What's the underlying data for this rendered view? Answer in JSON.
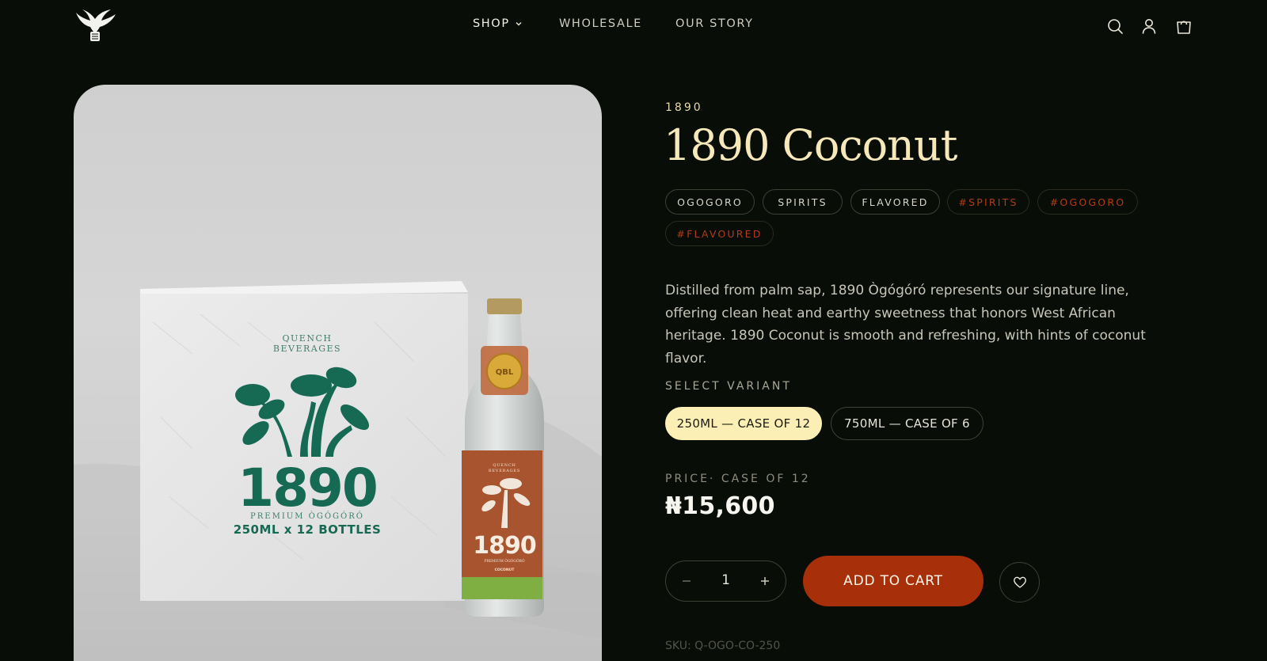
{
  "header": {
    "nav": [
      {
        "label": "SHOP"
      },
      {
        "label": "WHOLESALE"
      },
      {
        "label": "OUR STORY"
      }
    ],
    "icons": [
      "search-icon",
      "account-icon",
      "cart-icon"
    ]
  },
  "product_image": {
    "box_brand_line1": "QUENCH",
    "box_brand_line2": "BEVERAGES",
    "box_title": "1890",
    "box_subtitle": "PREMIUM ÒGÓGÓRÓ",
    "box_size": "250ML x 12 BOTTLES",
    "bottle_brand_line1": "QUENCH",
    "bottle_brand_line2": "BEVERAGES",
    "bottle_title": "1890",
    "bottle_subtitle": "PREMIUM ÒGÓGÓRÓ",
    "bottle_flavor": "COCONUT",
    "bottle_seal": "QBL"
  },
  "product": {
    "vendor": "1890",
    "title": "1890 Coconut",
    "tags": [
      {
        "label": "OGOGORO",
        "type": "category"
      },
      {
        "label": "SPIRITS",
        "type": "category"
      },
      {
        "label": "FLAVORED",
        "type": "category"
      },
      {
        "label": "#SPIRITS",
        "type": "hashtag"
      },
      {
        "label": "#OGOGORO",
        "type": "hashtag"
      },
      {
        "label": "#FLAVOURED",
        "type": "hashtag"
      }
    ],
    "description": "Distilled from palm sap, 1890 Ògógóró represents our signature line, offering clean heat and earthy sweetness that honors West African heritage. 1890 Coconut is smooth and refreshing, with hints of coconut flavor.",
    "select_variant_label": "SELECT VARIANT",
    "variants": [
      {
        "label": "250ML — CASE OF 12",
        "selected": true
      },
      {
        "label": "750ML — CASE OF 6",
        "selected": false
      }
    ],
    "price_label": "PRICE· CASE OF 12",
    "price": "₦15,600",
    "quantity": "1",
    "add_to_cart_label": "ADD TO CART",
    "sku": "SKU: Q-OGO-CO-250"
  },
  "colors": {
    "background": "#080d07",
    "accent": "#a72f09",
    "title": "#f6e8b8",
    "selected_variant": "#fcefb5",
    "hashtag": "#b23b18"
  }
}
